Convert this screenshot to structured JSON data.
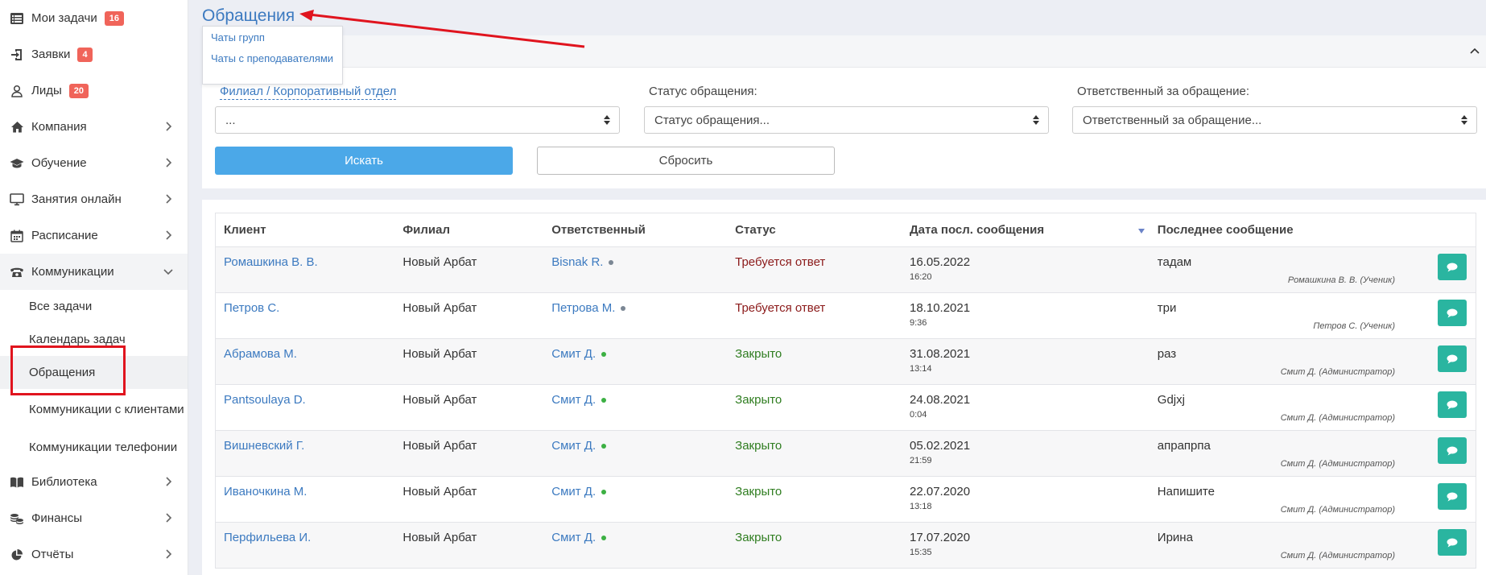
{
  "sidebar": {
    "items": [
      {
        "label": "Мои задачи",
        "badge": "16",
        "icon": "list-icon"
      },
      {
        "label": "Заявки",
        "badge": "4",
        "icon": "sign-in-icon"
      },
      {
        "label": "Лиды",
        "badge": "20",
        "icon": "user-icon"
      },
      {
        "label": "Компания",
        "icon": "home-icon"
      },
      {
        "label": "Обучение",
        "icon": "graduation-cap-icon"
      },
      {
        "label": "Занятия онлайн",
        "icon": "monitor-icon"
      },
      {
        "label": "Расписание",
        "icon": "calendar-icon"
      },
      {
        "label": "Коммуникации",
        "icon": "phone-icon"
      },
      {
        "label": "Библиотека",
        "icon": "book-icon"
      },
      {
        "label": "Финансы",
        "icon": "coins-icon"
      },
      {
        "label": "Отчёты",
        "icon": "pie-chart-icon"
      }
    ],
    "sub": [
      "Все задачи",
      "Календарь задач",
      "Обращения",
      "Коммуникации с клиентами",
      "Коммуникации телефонии"
    ]
  },
  "page": {
    "title": "Обращения",
    "dropdown": [
      "Чаты групп",
      "Чаты с преподавателями"
    ]
  },
  "filters": {
    "branch_label": "Филиал / Корпоративный отдел",
    "branch_value": "...",
    "status_label": "Статус обращения:",
    "status_value": "Статус обращения...",
    "responsible_label": "Ответственный за обращение:",
    "responsible_value": "Ответственный за обращение...",
    "search_button": "Искать",
    "reset_button": "Сбросить"
  },
  "table": {
    "headers": [
      "Клиент",
      "Филиал",
      "Ответственный",
      "Статус",
      "Дата посл. сообщения",
      "Последнее сообщение"
    ],
    "rows": [
      {
        "client": "Ромашкина В. В.",
        "branch": "Новый Арбат",
        "responsible": "Bisnak R.",
        "dot": "#7b8794",
        "status": "Требуется ответ",
        "status_type": "open",
        "date": "16.05.2022",
        "time": "16:20",
        "message": "тадам",
        "author": "Ромашкина В. В. (Ученик)"
      },
      {
        "client": "Петров С.",
        "branch": "Новый Арбат",
        "responsible": "Петрова М.",
        "dot": "#7b8794",
        "status": "Требуется ответ",
        "status_type": "open",
        "date": "18.10.2021",
        "time": "9:36",
        "message": "три",
        "author": "Петров С. (Ученик)"
      },
      {
        "client": "Абрамова М.",
        "branch": "Новый Арбат",
        "responsible": "Смит Д.",
        "dot": "#3cb043",
        "status": "Закрыто",
        "status_type": "closed",
        "date": "31.08.2021",
        "time": "13:14",
        "message": "раз",
        "author": "Смит Д. (Администратор)"
      },
      {
        "client": "Pantsoulaya D.",
        "branch": "Новый Арбат",
        "responsible": "Смит Д.",
        "dot": "#3cb043",
        "status": "Закрыто",
        "status_type": "closed",
        "date": "24.08.2021",
        "time": "0:04",
        "message": "Gdjxj",
        "author": "Смит Д. (Администратор)"
      },
      {
        "client": "Вишневский Г.",
        "branch": "Новый Арбат",
        "responsible": "Смит Д.",
        "dot": "#3cb043",
        "status": "Закрыто",
        "status_type": "closed",
        "date": "05.02.2021",
        "time": "21:59",
        "message": "апрапрпа",
        "author": "Смит Д. (Администратор)"
      },
      {
        "client": "Иваночкина М.",
        "branch": "Новый Арбат",
        "responsible": "Смит Д.",
        "dot": "#3cb043",
        "status": "Закрыто",
        "status_type": "closed",
        "date": "22.07.2020",
        "time": "13:18",
        "message": "Напишите",
        "author": "Смит Д. (Администратор)"
      },
      {
        "client": "Перфильева И.",
        "branch": "Новый Арбат",
        "responsible": "Смит Д.",
        "dot": "#3cb043",
        "status": "Закрыто",
        "status_type": "closed",
        "date": "17.07.2020",
        "time": "15:35",
        "message": "Ирина",
        "author": "Смит Д. (Администратор)"
      }
    ]
  },
  "colors": {
    "accent": "#3c7ac0",
    "search_btn": "#4ba8e8",
    "chat_btn": "#2ab5a0",
    "badge": "#f0645a",
    "annotation": "#e0141e"
  }
}
